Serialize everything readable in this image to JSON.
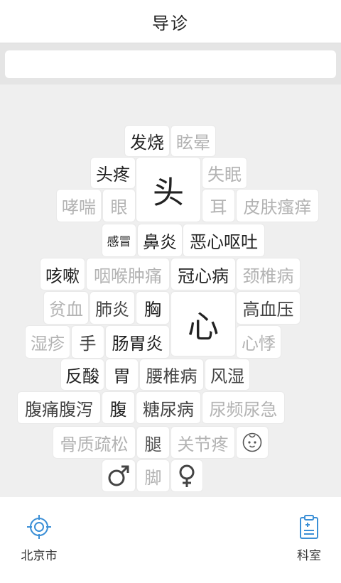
{
  "header": {
    "title": "导诊"
  },
  "search": {
    "value": "",
    "placeholder": ""
  },
  "symptoms": {
    "fashao": "发烧",
    "xuanyun": "眩晕",
    "touteng": "头疼",
    "tou": "头",
    "shimian": "失眠",
    "xiaochuan": "哮喘",
    "yan": "眼",
    "er": "耳",
    "pifusaoyang": "皮肤瘙痒",
    "ganmao": "感冒",
    "biyan": "鼻炎",
    "exinoutu": "恶心呕吐",
    "kesou": "咳嗽",
    "yanhouzhongtong": "咽喉肿痛",
    "guanxinbing": "冠心病",
    "jingzhuibing": "颈椎病",
    "pinxue": "贫血",
    "feiyan": "肺炎",
    "xiong": "胸",
    "xin": "心",
    "gaoxueya": "高血压",
    "shizhen": "湿疹",
    "shou": "手",
    "changweiyan": "肠胃炎",
    "xinji": "心悸",
    "fansuan": "反酸",
    "wei": "胃",
    "yaozhuibing": "腰椎病",
    "fengshi": "风湿",
    "futongfuxie": "腹痛腹泻",
    "fu": "腹",
    "tangniaobing": "糖尿病",
    "niaopinniaoji": "尿频尿急",
    "guzhishusong": "骨质疏松",
    "tui": "腿",
    "guanjieteng": "关节疼",
    "jiao": "脚"
  },
  "tabs": {
    "location": "北京市",
    "department": "科室"
  },
  "colors": {
    "accent": "#3b8fd6",
    "dark_text": "#222222",
    "light_text": "#b3b3b3"
  }
}
